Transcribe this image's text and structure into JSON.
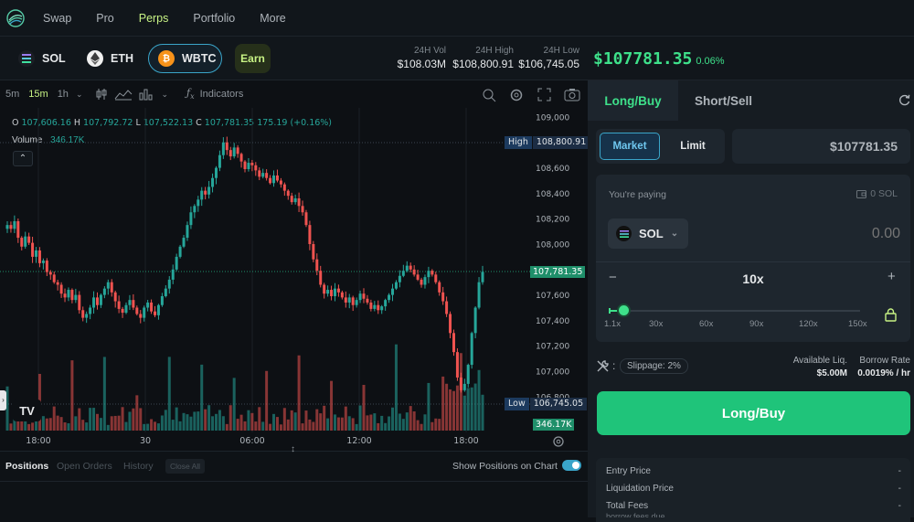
{
  "nav": {
    "items": [
      "Swap",
      "Pro",
      "Perps",
      "Portfolio",
      "More"
    ],
    "active": "Perps"
  },
  "tokens": {
    "sol": "SOL",
    "eth": "ETH",
    "wbtc": "WBTC",
    "earn": "Earn"
  },
  "stats": {
    "vol_label": "24H Vol",
    "vol_value": "$108.03M",
    "high_label": "24H High",
    "high_value": "$108,800.91",
    "low_label": "24H Low",
    "low_value": "$106,745.05",
    "price": "$107781.35",
    "change": "0.06%"
  },
  "chart_toolbar": {
    "intervals": [
      "5m",
      "15m",
      "1h"
    ],
    "active_interval": "15m",
    "indicators": "Indicators"
  },
  "chart_data": {
    "type": "candlestick",
    "ohlc_line": {
      "o_label": "O",
      "o": "107,606.16",
      "h_label": "H",
      "h": "107,792.72",
      "l_label": "L",
      "l": "107,522.13",
      "c_label": "C",
      "c": "107,781.35",
      "change": "175.19 (+0.16%)"
    },
    "volume_label": "Volume",
    "volume_value": "346.17K",
    "y_ticks": [
      "109,000",
      "108,800",
      "108,600",
      "108,400",
      "108,200",
      "108,000",
      "107,800",
      "107,600",
      "107,400",
      "107,200",
      "107,000",
      "106,800"
    ],
    "ylim": [
      106745,
      109000
    ],
    "x_ticks": [
      "18:00",
      "30",
      "06:00",
      "12:00",
      "18:00"
    ],
    "high_tag_label": "High",
    "high_tag_value": "108,800.91",
    "low_tag_label": "Low",
    "low_tag_value": "106,745.05",
    "current_price_tag": "107,781.35",
    "volume_tag": "346.17K",
    "colors": {
      "up": "#26a69a",
      "down": "#ef5350"
    },
    "closes": [
      108150,
      108120,
      108180,
      108050,
      107980,
      108060,
      108010,
      107900,
      107950,
      107850,
      107870,
      107780,
      107760,
      107700,
      107680,
      107610,
      107580,
      107640,
      107560,
      107600,
      107480,
      107420,
      107450,
      107500,
      107580,
      107520,
      107600,
      107650,
      107700,
      107620,
      107550,
      107490,
      107460,
      107520,
      107560,
      107500,
      107450,
      107420,
      107500,
      107540,
      107470,
      107440,
      107520,
      107590,
      107650,
      107720,
      107800,
      107900,
      107980,
      108050,
      108150,
      108250,
      108300,
      108350,
      108420,
      108390,
      108450,
      108520,
      108600,
      108700,
      108800,
      108740,
      108690,
      108760,
      108710,
      108650,
      108590,
      108640,
      108620,
      108580,
      108530,
      108560,
      108520,
      108480,
      108540,
      108500,
      108470,
      108420,
      108380,
      108330,
      108360,
      108300,
      108250,
      108150,
      108000,
      107880,
      107790,
      107680,
      107610,
      107640,
      107590,
      107650,
      107620,
      107580,
      107540,
      107580,
      107520,
      107560,
      107610,
      107570,
      107540,
      107490,
      107520,
      107480,
      107510,
      107560,
      107600,
      107650,
      107700,
      107750,
      107790,
      107830,
      107800,
      107760,
      107720,
      107680,
      107740,
      107790,
      107760,
      107700,
      107620,
      107550,
      107450,
      107300,
      107150,
      106950,
      106850,
      106900,
      107050,
      107300,
      107500,
      107700,
      107781
    ]
  },
  "bottom_tabs": {
    "positions": "Positions",
    "open_orders": "Open Orders",
    "history": "History",
    "close_all": "Close All",
    "show_positions": "Show Positions on Chart"
  },
  "panel": {
    "long_tab": "Long/Buy",
    "short_tab": "Short/Sell",
    "market": "Market",
    "limit": "Limit",
    "price_value": "$107781.35",
    "paying_label": "You're paying",
    "balance": "0 SOL",
    "pay_token": "SOL",
    "amount_placeholder": "0.00",
    "leverage": "10x",
    "leverage_marks": [
      "1.1x",
      "30x",
      "60x",
      "90x",
      "120x",
      "150x"
    ],
    "leverage_fraction": 0.06,
    "slippage": "Slippage: 2%",
    "avail_liq_label": "Available Liq.",
    "avail_liq_value": "$5.00M",
    "borrow_label": "Borrow Rate",
    "borrow_value": "0.0019% / hr",
    "cta": "Long/Buy",
    "entry_label": "Entry Price",
    "entry_value": "-",
    "liq_label": "Liquidation Price",
    "liq_value": "-",
    "fees_label": "Total Fees",
    "fees_value": "-",
    "borrow_fees_label": "borrow fees due"
  },
  "brand": {
    "green": "#1fc47a",
    "accent": "#c7f284"
  }
}
